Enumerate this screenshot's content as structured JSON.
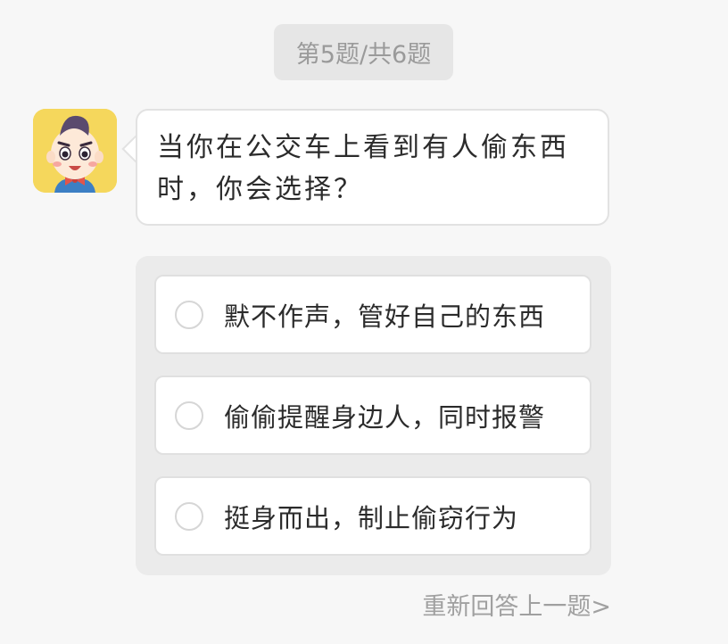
{
  "header": {
    "progress": "第5题/共6题"
  },
  "question": {
    "text": "当你在公交车上看到有人偷东西时，你会选择？"
  },
  "options": [
    {
      "label": "默不作声，管好自己的东西"
    },
    {
      "label": "偷偷提醒身边人，同时报警"
    },
    {
      "label": "挺身而出，制止偷窃行为"
    }
  ],
  "footer": {
    "back_label": "重新回答上一题>"
  },
  "colors": {
    "avatar_bg": "#f5d75c",
    "panel_bg": "#ebebeb",
    "page_bg": "#f7f7f7"
  }
}
